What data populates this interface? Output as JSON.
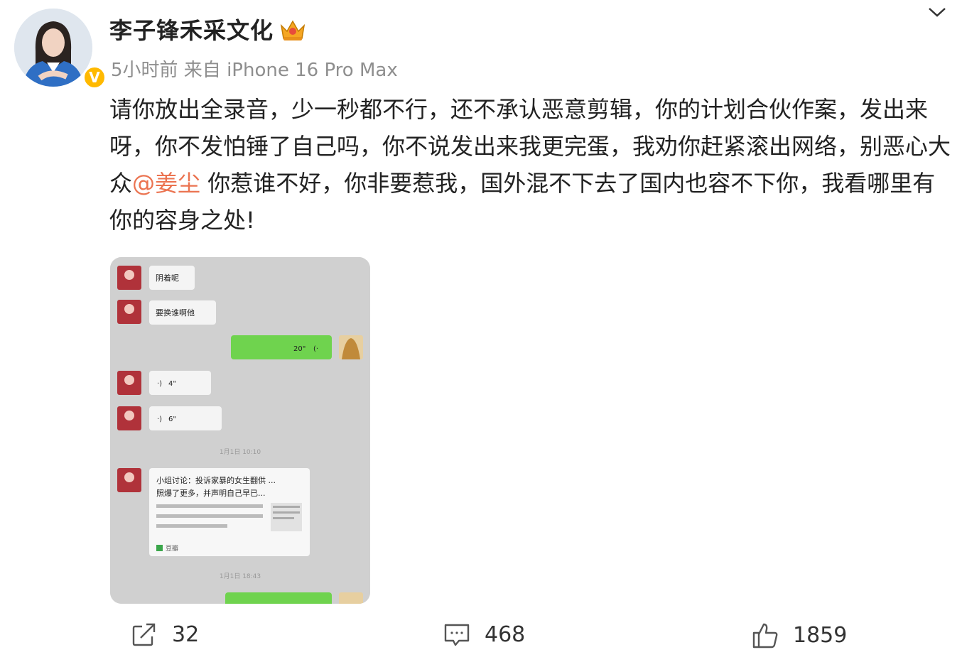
{
  "post": {
    "author_name": "李子锋禾采文化",
    "author_badge_icon": "crown-icon",
    "verified_icon": "verified-icon",
    "verified_mark": "V",
    "meta": "5小时前  来自 iPhone 16 Pro Max",
    "text_part1": "请你放出全录音，少一秒都不行，还不承认恶意剪辑，你的计划合伙作案，发出来呀，你不发怕锤了自己吗，你不说发出来我更完蛋，我劝你赶紧滚出网络，别恶心大众",
    "mention": "@姜尘",
    "text_part2": " 你惹谁不好，你非要惹我，国外混不下去了国内也容不下你，我看哪里有你的容身之处!"
  },
  "chat_screenshot": {
    "msg1": "阴着呢",
    "msg2": "要换谁啊他",
    "voice_out": "20\"",
    "voice_in1": "4\"",
    "voice_in2": "6\"",
    "time1": "1月1日 10:10",
    "card_title": "小组讨论：投诉家暴的女生翻供 ...",
    "card_line2": "照爆了更多，并声明自己早已...",
    "card_source": "豆瓣",
    "time2": "1月1日 18:43"
  },
  "actions": {
    "repost_count": "32",
    "comment_count": "468",
    "like_count": "1859"
  },
  "colors": {
    "mention": "#eb7350",
    "meta_gray": "#8e8e8e",
    "verified": "#ffb900",
    "wechat_green": "#95ec69"
  }
}
